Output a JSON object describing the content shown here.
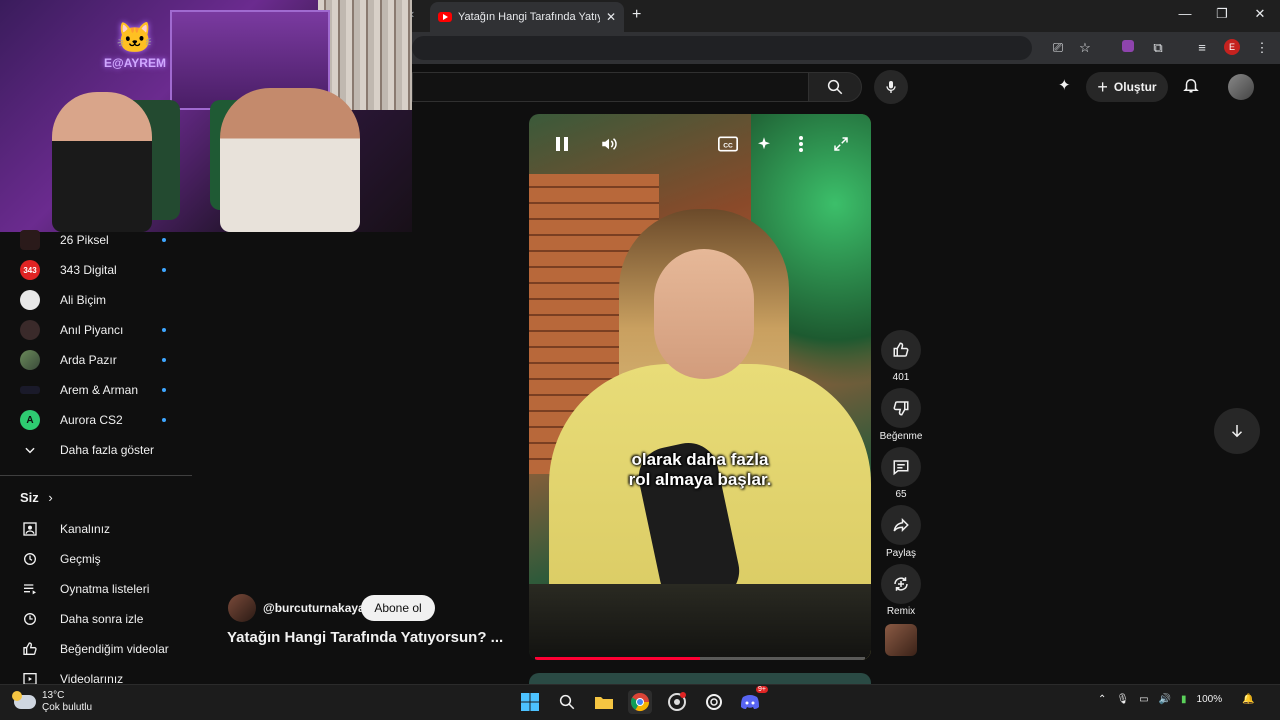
{
  "browser": {
    "tab_title": "Yatağın Hangi Tarafında Yatıyorsun? ...",
    "tab_close": "✕",
    "new_tab": "+",
    "profile_initial": "E"
  },
  "youtube": {
    "create_label": "Oluştur"
  },
  "webcam": {
    "logo_text": "E@AYREM"
  },
  "sidebar": {
    "subscriptions": [
      {
        "label": "26 Piksel",
        "badge": "",
        "dot": true
      },
      {
        "label": "343 Digital",
        "badge": "343",
        "dot": true
      },
      {
        "label": "Ali Biçim",
        "badge": "",
        "dot": false
      },
      {
        "label": "Anıl Piyancı",
        "badge": "",
        "dot": true
      },
      {
        "label": "Arda Pazır",
        "badge": "",
        "dot": true
      },
      {
        "label": "Arem & Arman",
        "badge": "",
        "dot": true
      },
      {
        "label": "Aurora CS2",
        "badge": "A",
        "dot": true
      }
    ],
    "show_more": "Daha fazla göster",
    "you_section": "Siz",
    "you_items": [
      {
        "label": "Kanalınız",
        "icon": "channel-icon"
      },
      {
        "label": "Geçmiş",
        "icon": "history-icon"
      },
      {
        "label": "Oynatma listeleri",
        "icon": "playlists-icon"
      },
      {
        "label": "Daha sonra izle",
        "icon": "watch-later-icon"
      },
      {
        "label": "Beğendiğim videolar",
        "icon": "liked-icon"
      },
      {
        "label": "Videolarınız",
        "icon": "your-videos-icon"
      }
    ]
  },
  "video": {
    "subtitle_line1": "olarak daha fazla",
    "subtitle_line2": "rol almaya başlar.",
    "progress": 0.5,
    "channel_handle": "@burcuturnakaya",
    "subscribe_label": "Abone ol",
    "title": "Yatağın Hangi Tarafında Yatıyorsun? ..."
  },
  "actions": {
    "like_count": "401",
    "dislike_label": "Beğenme",
    "comment_count": "65",
    "share_label": "Paylaş",
    "remix_label": "Remix"
  },
  "taskbar": {
    "temperature": "13°C",
    "weather_text": "Çok bulutlu",
    "battery": "100%",
    "discord_badge": "9+"
  }
}
